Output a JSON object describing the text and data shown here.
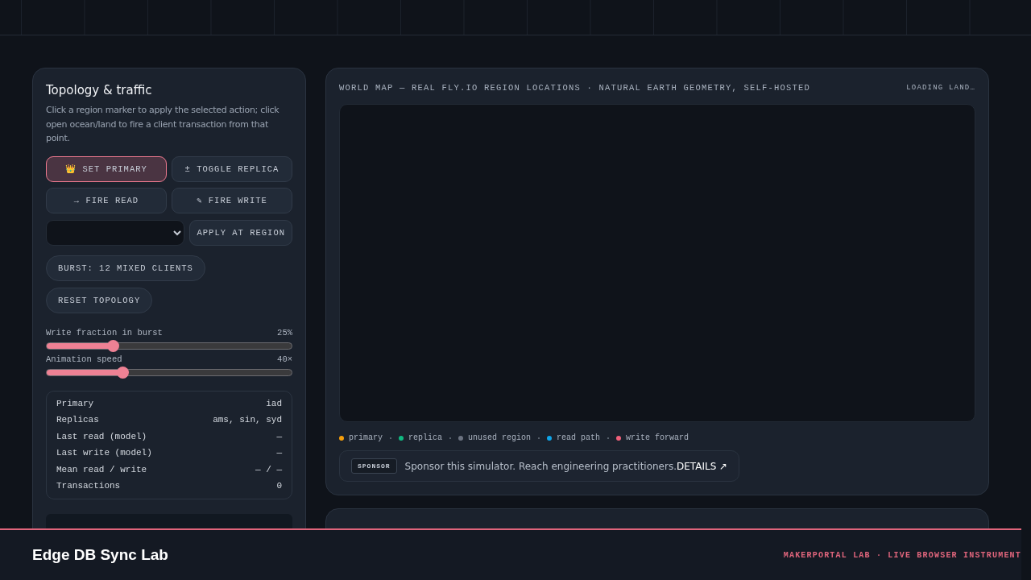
{
  "controls": {
    "title": "Topology & traffic",
    "description": "Click a region marker to apply the selected action; click open ocean/land to fire a client transaction from that point.",
    "actions": [
      {
        "icon": "👑",
        "label": "SET PRIMARY",
        "selected": true
      },
      {
        "icon": "±",
        "label": "TOGGLE REPLICA",
        "selected": false
      },
      {
        "icon": "→",
        "label": "FIRE READ",
        "selected": false
      },
      {
        "icon": "✎",
        "label": "FIRE WRITE",
        "selected": false
      }
    ],
    "apply_button": "APPLY AT REGION",
    "burst_button": "BURST: 12 MIXED CLIENTS",
    "reset_button": "RESET TOPOLOGY",
    "sliders": [
      {
        "label": "Write fraction in burst",
        "reading": "25%",
        "level": 0.27
      },
      {
        "label": "Animation speed",
        "reading": "40×",
        "level": 0.31
      }
    ],
    "stats": [
      {
        "label": "Primary",
        "value": "iad"
      },
      {
        "label": "Replicas",
        "value": "ams, sin, syd"
      },
      {
        "label": "Last read (model)",
        "value": "—"
      },
      {
        "label": "Last write (model)",
        "value": "—"
      },
      {
        "label": "Mean read / write",
        "value": "— / —"
      },
      {
        "label": "Transactions",
        "value": "0"
      }
    ]
  },
  "map": {
    "title": "WORLD MAP — REAL FLY.IO REGION LOCATIONS · NATURAL EARTH GEOMETRY, SELF-HOSTED",
    "status": "LOADING LAND…",
    "legend": [
      {
        "label": "primary",
        "color": "#f59e0b"
      },
      {
        "label": "replica",
        "color": "#10b981"
      },
      {
        "label": "unused region",
        "color": "#6b7280"
      },
      {
        "label": "read path",
        "color": "#0ea5e9"
      },
      {
        "label": "write forward",
        "color": "#f0607a"
      }
    ],
    "sponsor": {
      "badge": "SPONSOR",
      "text": "Sponsor this simulator. Reach engineering practitioners.",
      "link": "DETAILS ↗"
    }
  },
  "footer": {
    "title": "Edge DB Sync Lab",
    "tagline": "MAKERPORTAL LAB · LIVE BROWSER INSTRUMENT"
  }
}
